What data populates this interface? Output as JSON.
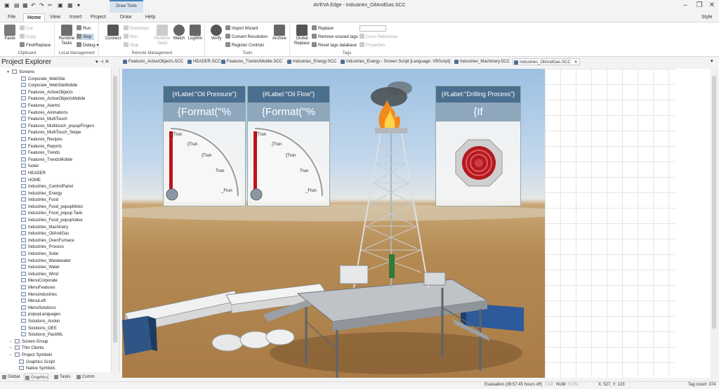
{
  "titlebar": {
    "title": "AVEVA Edge - Industries_OilAndGas.SCC",
    "context_tab": "Draw Tools"
  },
  "menu_tabs": [
    "File",
    "Home",
    "View",
    "Insert",
    "Project",
    "Draw",
    "Help"
  ],
  "style_label": "Style",
  "ribbon": {
    "clipboard": {
      "paste": "Paste",
      "cut": "Cut",
      "copy": "Copy",
      "find_replace": "Find/Replace",
      "label": "Clipboard"
    },
    "local": {
      "runtime_tasks": "Runtime Tasks",
      "run": "Run",
      "stop": "Stop",
      "debug": "Debug",
      "label": "Local Management"
    },
    "remote": {
      "connect": "Connect",
      "download": "Download",
      "run": "Run",
      "stop": "Stop",
      "runtime_tasks": "Runtime Tasks",
      "watch": "Watch",
      "logwin": "LogWin",
      "label": "Remote Management"
    },
    "tools": {
      "verify": "Verify",
      "import_wizard": "Import Wizard",
      "convert_resolution": "Convert Resolution",
      "register_controls": "Register Controls",
      "archive": "Archive",
      "label": "Tools"
    },
    "tags": {
      "global_replace": "Global Replace",
      "replace": "Replace",
      "remove_unused": "Remove unused tags",
      "reset_db": "Reset tags database",
      "cross_reference": "Cross Reference",
      "properties": "Properties",
      "label": "Tags"
    }
  },
  "project_explorer": {
    "title": "Project Explorer",
    "root": "Screens",
    "screens": [
      "Corporate_WebSite",
      "Corporate_WebSiteMobile",
      "Features_ActiveObjects",
      "Features_ActiveObjectsMobile",
      "Features_Alarms",
      "Features_Animations",
      "Features_MultiTouch",
      "Features_Multitouch_popupFingers",
      "Features_MultiTouch_Swipe",
      "Features_Recipes",
      "Features_Reports",
      "Features_Trends",
      "Features_TrendsMobile",
      "footer",
      "HEADER",
      "HOME",
      "Industries_ControlPanel",
      "Industries_Energy",
      "Industries_Food",
      "Industries_Food_popupMotor",
      "Industries_Food_popup Tank",
      "Industries_Food_popupValve",
      "Industries_Machinery",
      "Industries_OilAndGas",
      "Industries_OvenFurnace",
      "Industries_Process",
      "Industries_Solar",
      "Industries_Wastewater",
      "Industries_Water",
      "Industries_Wind",
      "MenuCorporate",
      "MenuFeatures",
      "MenuIndustries",
      "MenuLeft",
      "MenuSolutions",
      "popupLanguages",
      "Solutions_Andon",
      "Solutions_OEE",
      "Solutions_PackML"
    ],
    "folders": [
      "Screen Group",
      "Thin Clients",
      "Project Symbols",
      "Graphics Script",
      "Native Symbols"
    ]
  },
  "bottom_tabs": [
    "Global",
    "Graphics",
    "Tasks",
    "Comm"
  ],
  "doc_tabs": [
    "Features_ActiveObjects.SCC",
    "HEADER.SCC",
    "Features_Trends/Mobile.SCC",
    "Industries_Energy.SCC",
    "Industries_Energy - Screen Script [Language: VBScript]",
    "Industries_Machinery.SCC",
    "Industries_OilAndGas.SCC"
  ],
  "panels": [
    {
      "label": "{#Label:\"Oil Pressure\"}",
      "format": "{Format(\"%",
      "ticks": [
        "{Trun",
        "{Trun",
        "{Trun",
        "Trun",
        "_Frun"
      ]
    },
    {
      "label": "{#Label:\"Oil Flow\"}",
      "format": "{Format(\"%",
      "ticks": [
        "{Trun",
        "{Trun",
        "{Trun",
        "Trun",
        "_Frun"
      ]
    },
    {
      "label": "{#Label:\"Drilling Process\"}",
      "format": "{If"
    }
  ],
  "statusbar": {
    "evaluation": "Evaluation (39:57:45 hours off)",
    "cap": "CAP",
    "num": "NUM",
    "scrl": "SCRL",
    "coords": "527, Y: 123",
    "tag_count": "Tag count: 374"
  },
  "colors": {
    "accent": "#4a6f8f",
    "format_bar": "#8ea7bd",
    "gauge_needle": "#c0131a"
  }
}
